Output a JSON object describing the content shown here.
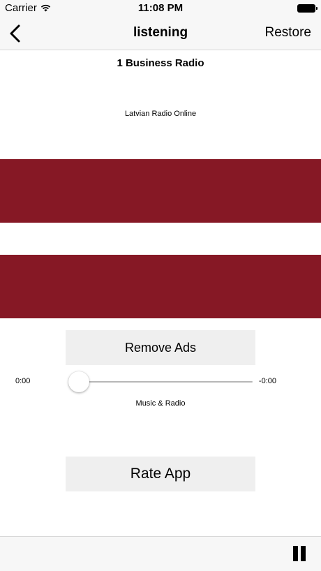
{
  "status_bar": {
    "carrier": "Carrier",
    "time": "11:08 PM"
  },
  "nav": {
    "back_icon": "chevron-left-icon",
    "title": "listening",
    "restore_label": "Restore"
  },
  "station": {
    "name": "1 Business Radio",
    "subtitle": "Latvian Radio Online"
  },
  "flag": {
    "colors": [
      "#861825",
      "#ffffff",
      "#861825"
    ],
    "proportions": [
      2,
      1,
      2
    ]
  },
  "buttons": {
    "remove_ads": "Remove Ads",
    "rate_app": "Rate App"
  },
  "player": {
    "elapsed": "0:00",
    "remaining": "-0:00",
    "progress": 0.0,
    "caption": "Music & Radio"
  },
  "toolbar": {
    "pause_icon": "pause-icon"
  },
  "colors": {
    "flag_red": "#861825",
    "bar_bg": "#f7f7f7",
    "button_bg": "#efefef"
  }
}
